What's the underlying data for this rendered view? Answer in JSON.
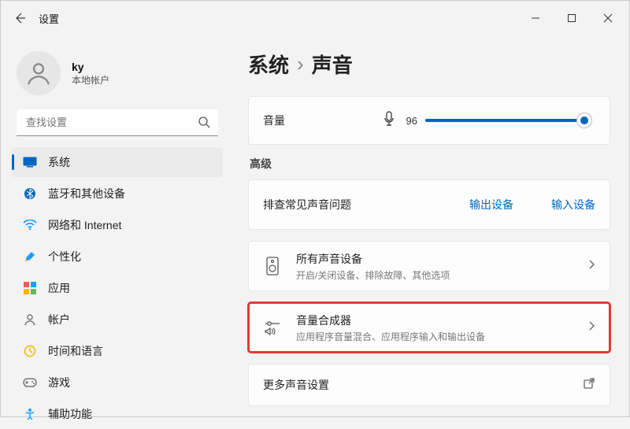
{
  "window": {
    "title": "设置"
  },
  "user": {
    "name": "ky",
    "subtitle": "本地帐户"
  },
  "search": {
    "placeholder": "查找设置"
  },
  "nav": {
    "items": [
      {
        "label": "系统"
      },
      {
        "label": "蓝牙和其他设备"
      },
      {
        "label": "网络和 Internet"
      },
      {
        "label": "个性化"
      },
      {
        "label": "应用"
      },
      {
        "label": "帐户"
      },
      {
        "label": "时间和语言"
      },
      {
        "label": "游戏"
      },
      {
        "label": "辅助功能"
      }
    ]
  },
  "breadcrumb": {
    "root": "系统",
    "sep": "›",
    "leaf": "声音"
  },
  "volume": {
    "label": "音量",
    "value": "96",
    "percent": 96
  },
  "section_advanced": "高级",
  "troubleshoot": {
    "label": "排查常见声音问题",
    "link_output": "输出设备",
    "link_input": "输入设备"
  },
  "all_devices": {
    "title": "所有声音设备",
    "sub": "开启/关闭设备、排除故障、其他选项"
  },
  "mixer": {
    "title": "音量合成器",
    "sub": "应用程序音量混合、应用程序输入和输出设备"
  },
  "more": {
    "title": "更多声音设置"
  }
}
